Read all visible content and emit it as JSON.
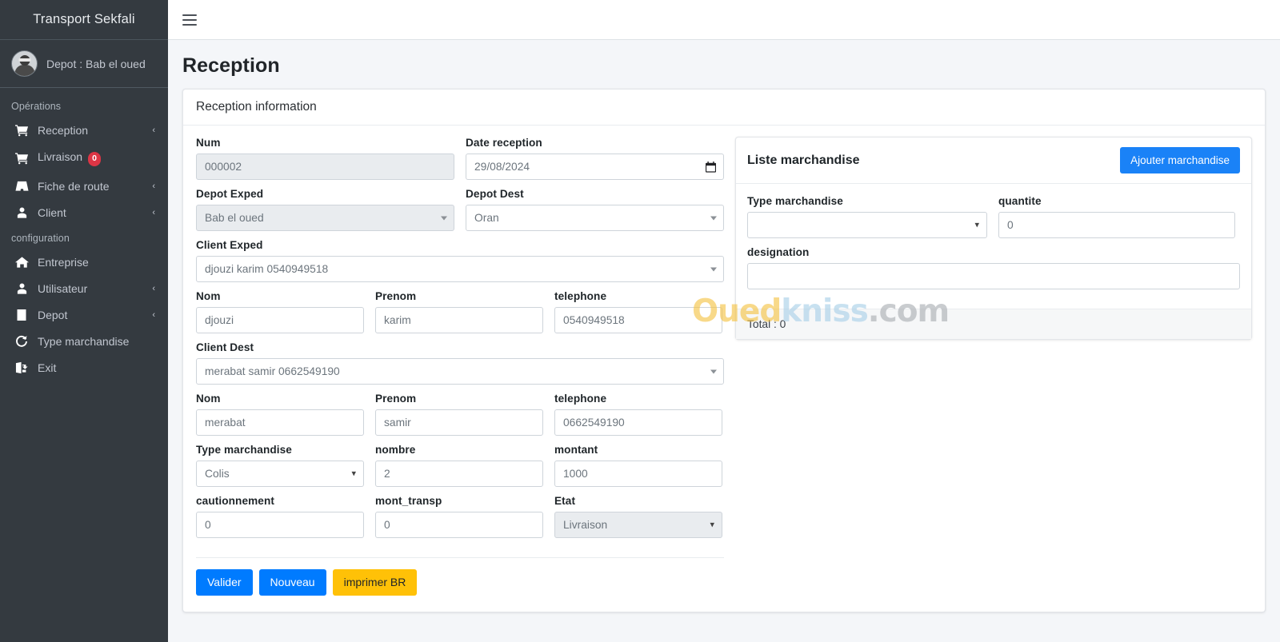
{
  "sidebar": {
    "brand": "Transport Sekfali",
    "user": {
      "label": "Depot : Bab el oued",
      "avatar_icon": "user-avatar-photo"
    },
    "sections": [
      {
        "header": "Opérations",
        "items": [
          {
            "label": "Reception",
            "icon": "cart-plus-icon",
            "chevron": "‹",
            "badge": null
          },
          {
            "label": "Livraison",
            "icon": "cart-plus-icon",
            "chevron": null,
            "badge": "0"
          },
          {
            "label": "Fiche de route",
            "icon": "road-icon",
            "chevron": "‹",
            "badge": null
          },
          {
            "label": "Client",
            "icon": "user-icon",
            "chevron": "‹",
            "badge": null
          }
        ]
      },
      {
        "header": "configuration",
        "items": [
          {
            "label": "Entreprise",
            "icon": "home-icon",
            "chevron": null,
            "badge": null
          },
          {
            "label": "Utilisateur",
            "icon": "user-icon",
            "chevron": "‹",
            "badge": null
          },
          {
            "label": "Depot",
            "icon": "building-icon",
            "chevron": "‹",
            "badge": null
          },
          {
            "label": "Type marchandise",
            "icon": "refresh-icon",
            "chevron": null,
            "badge": null
          },
          {
            "label": "Exit",
            "icon": "logout-icon",
            "chevron": null,
            "badge": null
          }
        ]
      }
    ]
  },
  "topbar": {
    "menu_icon": "hamburger-icon"
  },
  "page": {
    "title": "Reception"
  },
  "card": {
    "header": "Reception information",
    "fields": {
      "num": {
        "label": "Num",
        "value": "000002",
        "disabled": true
      },
      "date_reception": {
        "label": "Date reception",
        "value": "29/08/2024"
      },
      "depot_exped": {
        "label": "Depot Exped",
        "value": "Bab el oued",
        "disabled": true
      },
      "depot_dest": {
        "label": "Depot Dest",
        "value": "Oran"
      },
      "client_exped": {
        "label": "Client Exped",
        "value": "djouzi karim 0540949518"
      },
      "exped_nom": {
        "label": "Nom",
        "value": "djouzi"
      },
      "exped_prenom": {
        "label": "Prenom",
        "value": "karim"
      },
      "exped_tel": {
        "label": "telephone",
        "value": "0540949518"
      },
      "client_dest": {
        "label": "Client Dest",
        "value": "merabat samir 0662549190"
      },
      "dest_nom": {
        "label": "Nom",
        "value": "merabat"
      },
      "dest_prenom": {
        "label": "Prenom",
        "value": "samir"
      },
      "dest_tel": {
        "label": "telephone",
        "value": "0662549190"
      },
      "type_march": {
        "label": "Type marchandise",
        "value": "Colis"
      },
      "nombre": {
        "label": "nombre",
        "value": "2"
      },
      "montant": {
        "label": "montant",
        "value": "1000"
      },
      "cautionnement": {
        "label": "cautionnement",
        "value": "0"
      },
      "mont_transp": {
        "label": "mont_transp",
        "value": "0"
      },
      "etat": {
        "label": "Etat",
        "value": "Livraison",
        "disabled": true
      }
    },
    "buttons": {
      "valider": "Valider",
      "nouveau": "Nouveau",
      "imprimer": "imprimer BR"
    }
  },
  "marchandise_panel": {
    "title": "Liste marchandise",
    "add_button": "Ajouter marchandise",
    "fields": {
      "type_marchandise": {
        "label": "Type marchandise",
        "value": ""
      },
      "quantite": {
        "label": "quantite",
        "value": "0"
      },
      "designation": {
        "label": "designation",
        "value": ""
      }
    },
    "total": "Total : 0"
  },
  "watermark": {
    "part1": "Oued",
    "part2": "kniss",
    "part3": ".com"
  },
  "colors": {
    "sidebar_bg": "#343a40",
    "primary": "#007bff",
    "add_blue": "#1a82f7",
    "warning": "#ffc107",
    "badge_red": "#dc3545",
    "page_bg": "#f4f6f9"
  }
}
